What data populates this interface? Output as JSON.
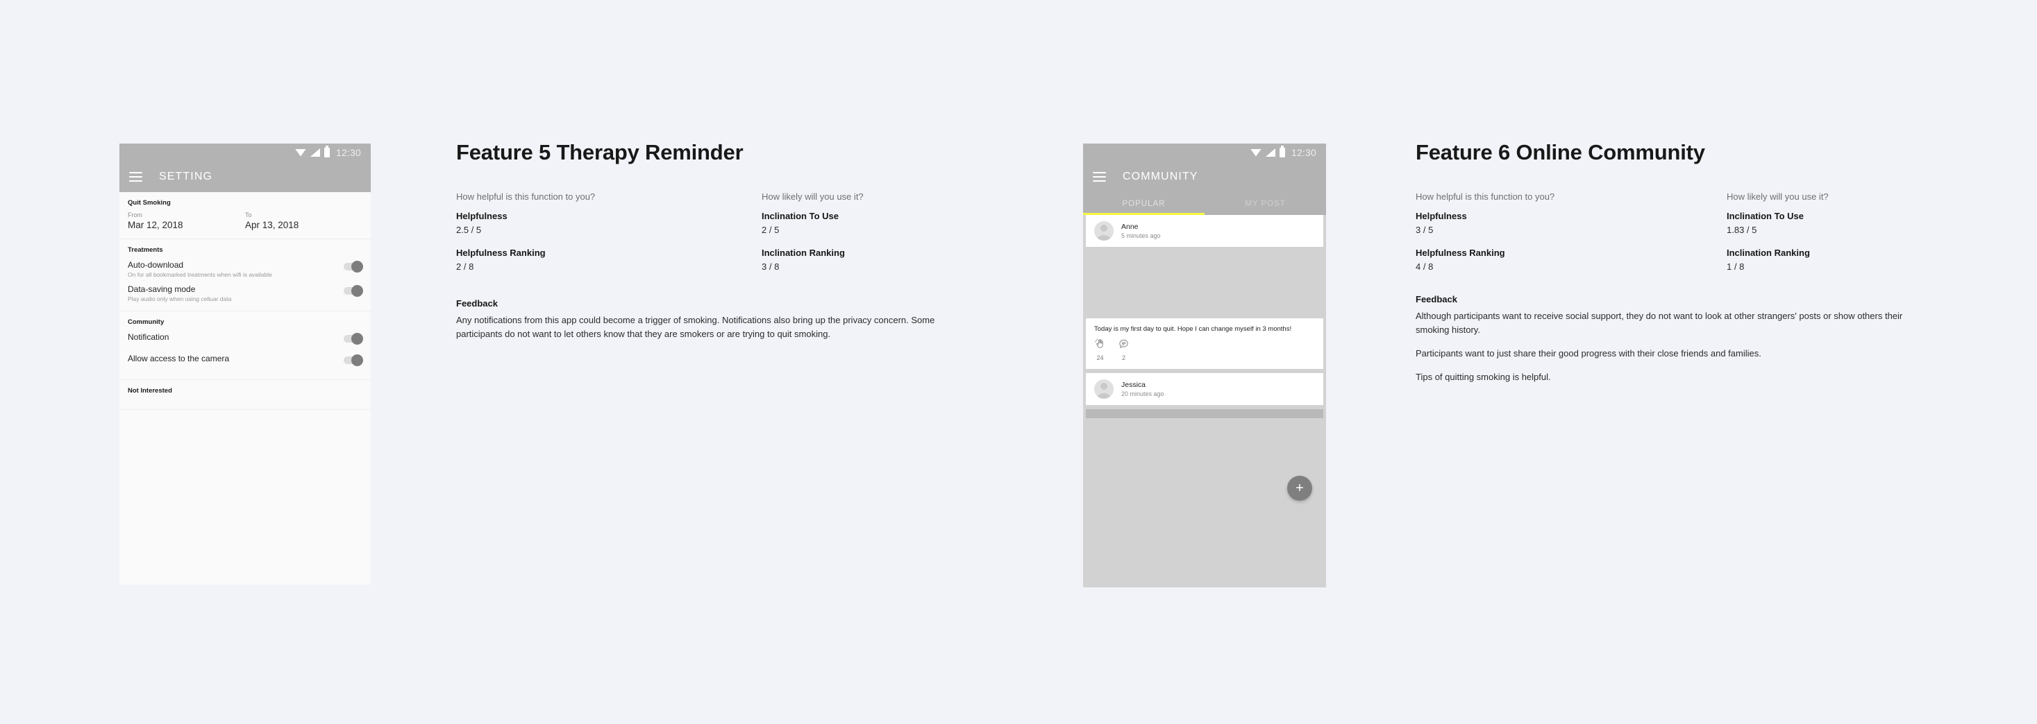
{
  "settings_phone": {
    "status": {
      "time": "12:30",
      "icons": [
        "wifi-icon",
        "signal-icon",
        "battery-icon"
      ]
    },
    "menu_icon": "hamburger-menu-icon",
    "title": "SETTING",
    "sections": [
      {
        "title": "Quit Smoking",
        "dates": [
          {
            "label": "From",
            "value": "Mar 12, 2018"
          },
          {
            "label": "To",
            "value": "Apr 13, 2018"
          }
        ]
      },
      {
        "title": "Treatments",
        "options": [
          {
            "label": "Auto-download",
            "sub": "On for all bookmarked treatments when wifi is available",
            "state": "on"
          },
          {
            "label": "Data-saving mode",
            "sub": "Play audio only when using celluar data",
            "state": "on"
          }
        ]
      },
      {
        "title": "Community",
        "options": [
          {
            "label": "Notification",
            "sub": "",
            "state": "on"
          },
          {
            "label": "Allow access to the camera",
            "sub": "",
            "state": "on"
          }
        ]
      },
      {
        "title": "Not Interested",
        "options": []
      }
    ]
  },
  "community_phone": {
    "status": {
      "time": "12:30"
    },
    "menu_icon": "hamburger-menu-icon",
    "title": "COMMUNITY",
    "tabs": [
      {
        "label": "POPULAR",
        "active": true
      },
      {
        "label": "MY POST",
        "active": false
      }
    ],
    "posts": [
      {
        "author": "Anne",
        "time": "5 minutes ago",
        "text": "Today is my first day to quit. Hope I can change myself in 3 months!",
        "claps": "24",
        "comments": "2"
      },
      {
        "author": "Jessica",
        "time": "20 minutes ago"
      }
    ],
    "fab_label": "+",
    "accent_color": "#f7f73f"
  },
  "feature5": {
    "title": "Feature 5 Therapy Reminder",
    "left": {
      "question": "How helpful is this function to you?",
      "metric_label": "Helpfulness",
      "metric_value": "2.5 / 5",
      "rank_label": "Helpfulness Ranking",
      "rank_value": "2 / 8"
    },
    "right": {
      "question": "How likely will you use it?",
      "metric_label": "Inclination To Use",
      "metric_value": "2 / 5",
      "rank_label": "Inclination Ranking",
      "rank_value": "3 / 8"
    },
    "feedback_title": "Feedback",
    "feedback_paragraphs": [
      "Any notifications from this app could become a trigger of smoking. Notifications also bring up the privacy concern. Some participants do not want to let others know that they are smokers or are trying to quit smoking."
    ]
  },
  "feature6": {
    "title": "Feature 6 Online Community",
    "left": {
      "question": "How helpful is this function to you?",
      "metric_label": "Helpfulness",
      "metric_value": "3 / 5",
      "rank_label": "Helpfulness Ranking",
      "rank_value": "4 / 8"
    },
    "right": {
      "question": "How likely will you use it?",
      "metric_label": "Inclination To Use",
      "metric_value": "1.83 / 5",
      "rank_label": "Inclination Ranking",
      "rank_value": "1 / 8"
    },
    "feedback_title": "Feedback",
    "feedback_paragraphs": [
      "Although participants want to receive social support, they do not want to look at other strangers' posts or show others their smoking history.",
      "Participants want to just share their good progress with their close friends and families.",
      "Tips of quitting smoking is helpful."
    ]
  }
}
